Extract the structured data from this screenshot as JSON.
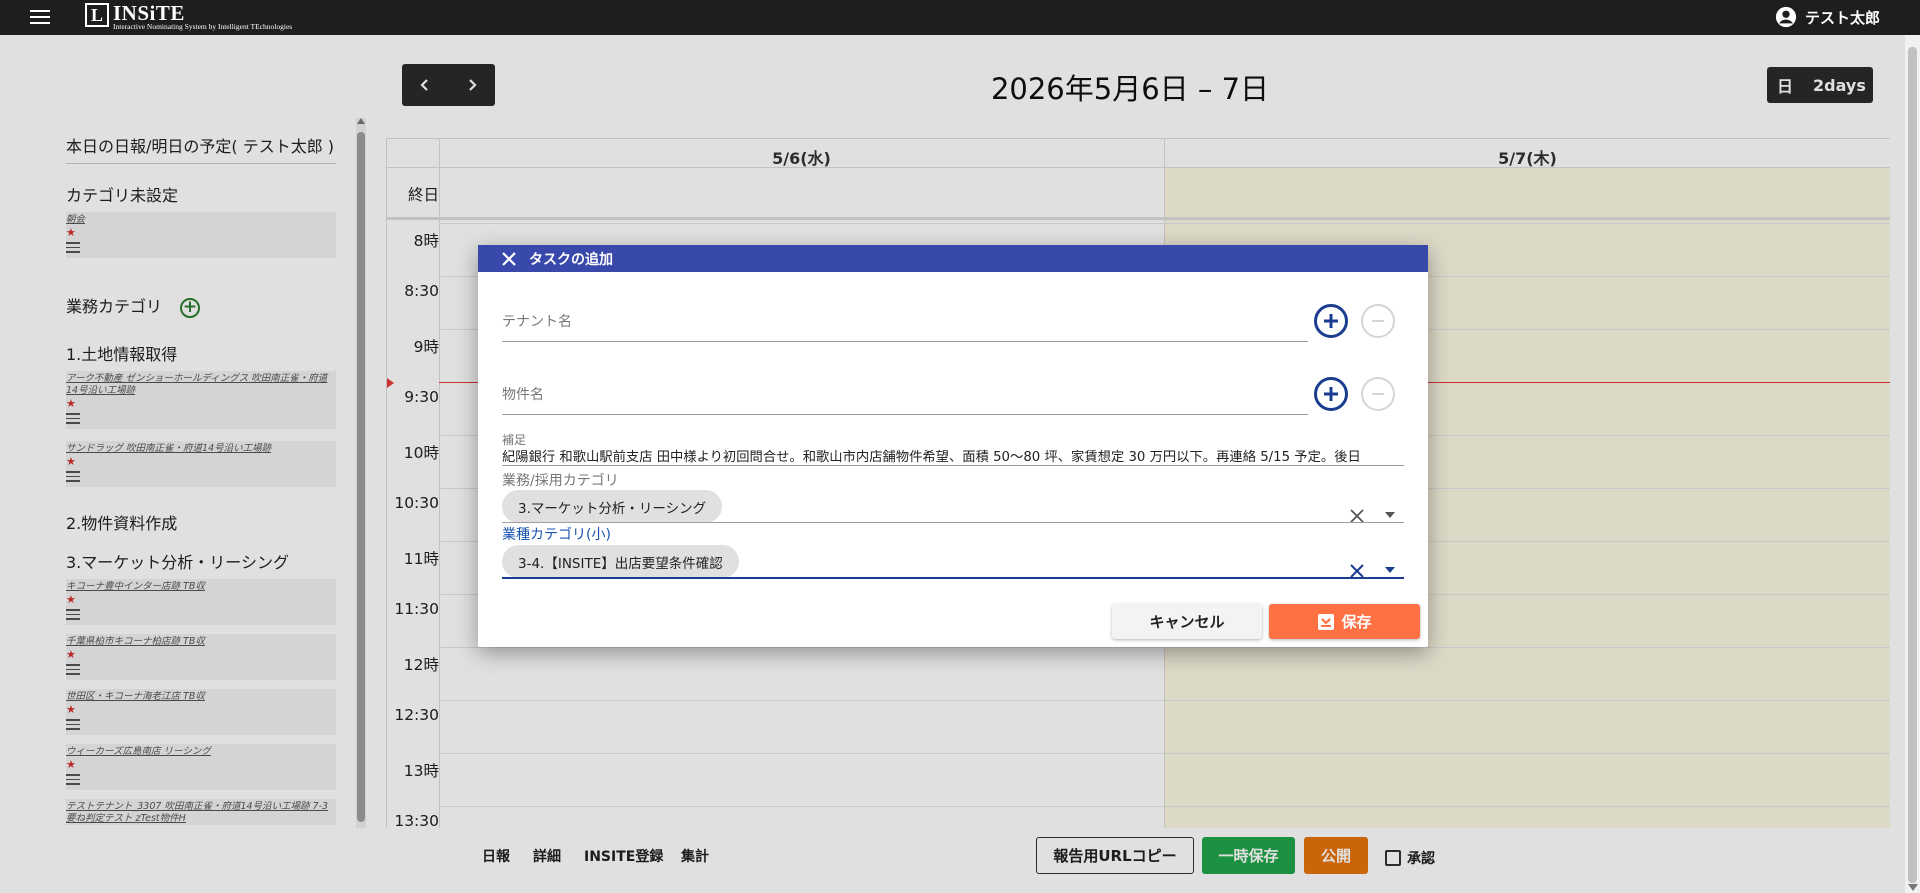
{
  "app": {
    "logo_letter": "L",
    "logo_name": "INSiTE",
    "logo_sub": "Interactive Nominating System by Intelligent TEchnologies",
    "user_name": "テスト太郎"
  },
  "calendar": {
    "title": "2026年5月6日 – 7日",
    "view_day": "日",
    "view_2days": "2days",
    "columns": [
      "5/6(水)",
      "5/7(木)"
    ],
    "allday_label": "終日",
    "time_labels": [
      "8時",
      "8:30",
      "9時",
      "9:30",
      "10時",
      "10:30",
      "11時",
      "11:30",
      "12時",
      "12:30",
      "13時",
      "13:30"
    ]
  },
  "sidebar": {
    "title": "本日の日報/明日の予定( テスト太郎 )",
    "uncategorized_heading": "カテゴリ未設定",
    "uncategorized_items": [
      {
        "title": "朝会"
      }
    ],
    "business_heading": "業務カテゴリ",
    "sections": [
      {
        "heading": "1.土地情報取得",
        "items": [
          {
            "title": "アーク不動産 ゼンショーホールディングス 吹田南正雀・府道14号沿い工場跡"
          },
          {
            "title": "サンドラッグ 吹田南正雀・府道14号沿い工場跡"
          }
        ]
      },
      {
        "heading": "2.物件資料作成",
        "items": []
      },
      {
        "heading": "3.マーケット分析・リーシング",
        "items": [
          {
            "title": "キコーナ豊中インター店跡 TB収"
          },
          {
            "title": "千葉県柏市キコーナ柏店跡 TB収"
          },
          {
            "title": "世田区・キコーナ海老江店 TB収"
          },
          {
            "title": "ウィーカーズ広島南店 リーシング"
          },
          {
            "title": "テストテナント_3307 吹田南正雀・府道14号沿い工場跡 7-3 要ね判定テスト zTest物件H"
          }
        ]
      }
    ]
  },
  "bottom_bar": {
    "links": [
      "日報",
      "詳細",
      "INSITE登録",
      "集計"
    ],
    "copy_url": "報告用URLコピー",
    "temp_save": "一時保存",
    "publish": "公開",
    "approve": "承認"
  },
  "dialog": {
    "title": "タスクの追加",
    "tenant_placeholder": "テナント名",
    "property_placeholder": "物件名",
    "notes_label": "補足",
    "notes_value": "紀陽銀行 和歌山駅前支店 田中様より初回問合せ。和歌山市内店舗物件希望、面積 50〜80 坪、家賃想定 30 万円以下。再連絡 5/15 予定。後日",
    "category_label": "業務/採用カテゴリ",
    "category_value": "3.マーケット分析・リーシング",
    "subcategory_label": "業種カテゴリ(小)",
    "subcategory_value": "3-4.【INSITE】出店要望条件確認",
    "cancel": "キャンセル",
    "save": "保存"
  },
  "colors": {
    "dialog_header": "#3949ab",
    "save_button": "#ff7043",
    "temp_save_button": "#1fa64a",
    "publish_button": "#e8730c",
    "today_column": "#fcf8e3",
    "now_line": "#e53935",
    "add_circle": "#1a3d8f",
    "category_add": "#2e7d32"
  },
  "icons": [
    "menu-icon",
    "account-circle-icon",
    "chevron-left-icon",
    "chevron-right-icon",
    "close-icon",
    "add-circle-icon",
    "remove-circle-icon",
    "clear-icon",
    "dropdown-arrow-icon",
    "save-icon"
  ]
}
